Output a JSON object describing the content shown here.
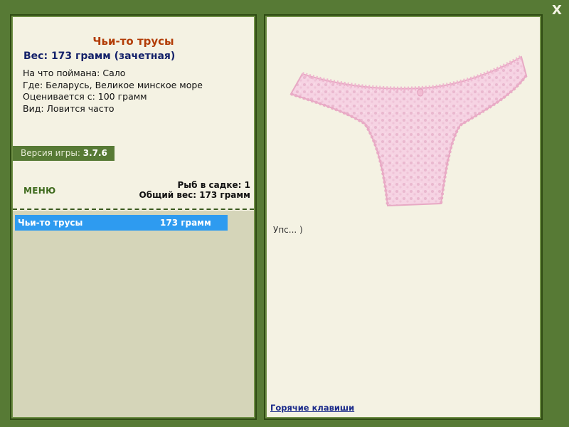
{
  "window": {
    "close_label": "X"
  },
  "fish": {
    "title": "Чьи-то трусы",
    "weight_line": "Вес: 173 грамм (зачетная)",
    "info": [
      "На что поймана: Сало",
      "Где: Беларусь, Великое минское море",
      "Оценивается с: 100 грамм",
      "Вид: Ловится часто"
    ]
  },
  "version": {
    "label": "Версия игры: ",
    "value": "3.7.6"
  },
  "menu": {
    "label": "МЕНЮ"
  },
  "cage": {
    "count_line": "Рыб в садке: 1",
    "total_line": "Общий вес: 173 грамм",
    "items": [
      {
        "name": "Чьи-то трусы",
        "weight": "173 грамм"
      }
    ]
  },
  "message": {
    "text": "Упс... )"
  },
  "hotkeys": {
    "label": "Горячие клавиши"
  },
  "colors": {
    "frame_green": "#577a35",
    "panel_bg": "#f4f2e3",
    "title_red": "#b23c06",
    "weight_blue": "#14226a",
    "selection_blue": "#2e9bf0",
    "item_pink": "#f5cfe0"
  }
}
